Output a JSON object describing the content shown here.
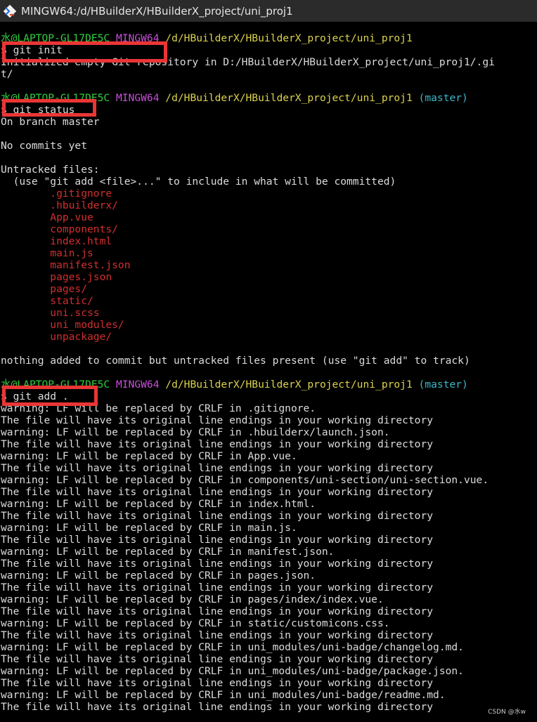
{
  "window": {
    "title": "MINGW64:/d/HBuilderX/HBuilderX_project/uni_proj1",
    "icon": "git-bash-icon"
  },
  "colors": {
    "user": "#2fcf3f",
    "host": "#c64fd8",
    "path": "#dbd24a",
    "branch": "#3bb8c9",
    "untracked": "#d12f2f",
    "highlight": "#ea3535"
  },
  "terminal": {
    "lines": [
      {
        "segments": [
          {
            "t": "水@LAPTOP-GL17DE5C",
            "c": "user"
          },
          {
            "t": " "
          },
          {
            "t": "MINGW64",
            "c": "host"
          },
          {
            "t": " "
          },
          {
            "t": "/d/HBuilderX/HBuilderX_project/uni_proj1",
            "c": "path"
          }
        ]
      },
      {
        "text": "$ git init"
      },
      {
        "text": "Initialized empty Git repository in D:/HBuilderX/HBuilderX_project/uni_proj1/.gi"
      },
      {
        "text": "t/"
      },
      {
        "text": ""
      },
      {
        "segments": [
          {
            "t": "水@LAPTOP-GL17DE5C",
            "c": "user"
          },
          {
            "t": " "
          },
          {
            "t": "MINGW64",
            "c": "host"
          },
          {
            "t": " "
          },
          {
            "t": "/d/HBuilderX/HBuilderX_project/uni_proj1",
            "c": "path"
          },
          {
            "t": " "
          },
          {
            "t": "(master)",
            "c": "branch"
          }
        ]
      },
      {
        "text": "$ git status"
      },
      {
        "text": "On branch master"
      },
      {
        "text": ""
      },
      {
        "text": "No commits yet"
      },
      {
        "text": ""
      },
      {
        "text": "Untracked files:"
      },
      {
        "text": "  (use \"git add <file>...\" to include in what will be committed)"
      },
      {
        "text": "        .gitignore",
        "c": "untracked"
      },
      {
        "text": "        .hbuilderx/",
        "c": "untracked"
      },
      {
        "text": "        App.vue",
        "c": "untracked"
      },
      {
        "text": "        components/",
        "c": "untracked"
      },
      {
        "text": "        index.html",
        "c": "untracked"
      },
      {
        "text": "        main.js",
        "c": "untracked"
      },
      {
        "text": "        manifest.json",
        "c": "untracked"
      },
      {
        "text": "        pages.json",
        "c": "untracked"
      },
      {
        "text": "        pages/",
        "c": "untracked"
      },
      {
        "text": "        static/",
        "c": "untracked"
      },
      {
        "text": "        uni.scss",
        "c": "untracked"
      },
      {
        "text": "        uni_modules/",
        "c": "untracked"
      },
      {
        "text": "        unpackage/",
        "c": "untracked"
      },
      {
        "text": ""
      },
      {
        "text": "nothing added to commit but untracked files present (use \"git add\" to track)"
      },
      {
        "text": ""
      },
      {
        "segments": [
          {
            "t": "水@LAPTOP-GL17DE5C",
            "c": "user"
          },
          {
            "t": " "
          },
          {
            "t": "MINGW64",
            "c": "host"
          },
          {
            "t": " "
          },
          {
            "t": "/d/HBuilderX/HBuilderX_project/uni_proj1",
            "c": "path"
          },
          {
            "t": " "
          },
          {
            "t": "(master)",
            "c": "branch"
          }
        ]
      },
      {
        "text": "$ git add ."
      },
      {
        "text": "warning: LF will be replaced by CRLF in .gitignore."
      },
      {
        "text": "The file will have its original line endings in your working directory"
      },
      {
        "text": "warning: LF will be replaced by CRLF in .hbuilderx/launch.json."
      },
      {
        "text": "The file will have its original line endings in your working directory"
      },
      {
        "text": "warning: LF will be replaced by CRLF in App.vue."
      },
      {
        "text": "The file will have its original line endings in your working directory"
      },
      {
        "text": "warning: LF will be replaced by CRLF in components/uni-section/uni-section.vue."
      },
      {
        "text": "The file will have its original line endings in your working directory"
      },
      {
        "text": "warning: LF will be replaced by CRLF in index.html."
      },
      {
        "text": "The file will have its original line endings in your working directory"
      },
      {
        "text": "warning: LF will be replaced by CRLF in main.js."
      },
      {
        "text": "The file will have its original line endings in your working directory"
      },
      {
        "text": "warning: LF will be replaced by CRLF in manifest.json."
      },
      {
        "text": "The file will have its original line endings in your working directory"
      },
      {
        "text": "warning: LF will be replaced by CRLF in pages.json."
      },
      {
        "text": "The file will have its original line endings in your working directory"
      },
      {
        "text": "warning: LF will be replaced by CRLF in pages/index/index.vue."
      },
      {
        "text": "The file will have its original line endings in your working directory"
      },
      {
        "text": "warning: LF will be replaced by CRLF in static/customicons.css."
      },
      {
        "text": "The file will have its original line endings in your working directory"
      },
      {
        "text": "warning: LF will be replaced by CRLF in uni_modules/uni-badge/changelog.md."
      },
      {
        "text": "The file will have its original line endings in your working directory"
      },
      {
        "text": "warning: LF will be replaced by CRLF in uni_modules/uni-badge/package.json."
      },
      {
        "text": "The file will have its original line endings in your working directory"
      },
      {
        "text": "warning: LF will be replaced by CRLF in uni_modules/uni-badge/readme.md."
      },
      {
        "text": "The file will have its original line endings in your working directory"
      }
    ]
  },
  "highlights": [
    {
      "name": "git-init",
      "line": 1
    },
    {
      "name": "git-status",
      "line": 6
    },
    {
      "name": "git-add",
      "line": 31
    }
  ],
  "watermark": "CSDN @水w"
}
